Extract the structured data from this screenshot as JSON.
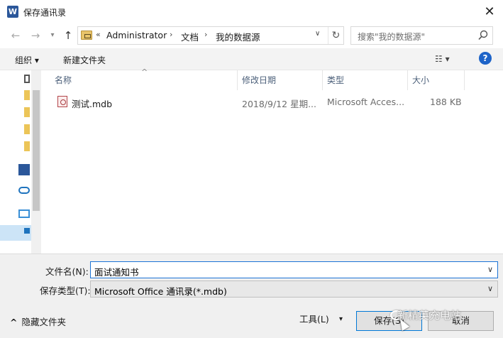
{
  "window": {
    "title": "保存通讯录",
    "app_icon": "W"
  },
  "nav": {
    "back_icon": "←",
    "forward_icon": "→",
    "up_icon": "↑",
    "breadcrumb_prefix": "«",
    "crumbs": [
      "Administrator",
      "文档",
      "我的数据源"
    ],
    "sep": "›",
    "refresh_icon": "↻",
    "search_placeholder": "搜索\"我的数据源\""
  },
  "toolbar": {
    "organize": "组织 ▾",
    "new_folder": "新建文件夹",
    "help": "?",
    "view_icon": "☷ ▾"
  },
  "columns": {
    "name": "名称",
    "modified": "修改日期",
    "type": "类型",
    "size": "大小",
    "sort_arrow": "^"
  },
  "files": [
    {
      "name": "测试.mdb",
      "modified": "2018/9/12 星期...",
      "type": "Microsoft Acces...",
      "size": "188 KB"
    }
  ],
  "form": {
    "filename_label": "文件名(N):",
    "filename_value": "面试通知书",
    "filetype_label": "保存类型(T):",
    "filetype_value": "Microsoft Office 通讯录(*.mdb)",
    "dropdown_arrow": "∨"
  },
  "footer": {
    "hide_folders": "隐藏文件夹",
    "hide_icon": "^",
    "tools": "工具(L)",
    "tools_arrow": "▾",
    "save": "保存(S)",
    "cancel": "取消"
  },
  "watermark": "新精英充电站",
  "close_icon": "✕",
  "colors": {
    "accent": "#0078d7",
    "selection": "#cce4f7",
    "help": "#1d63c8"
  }
}
